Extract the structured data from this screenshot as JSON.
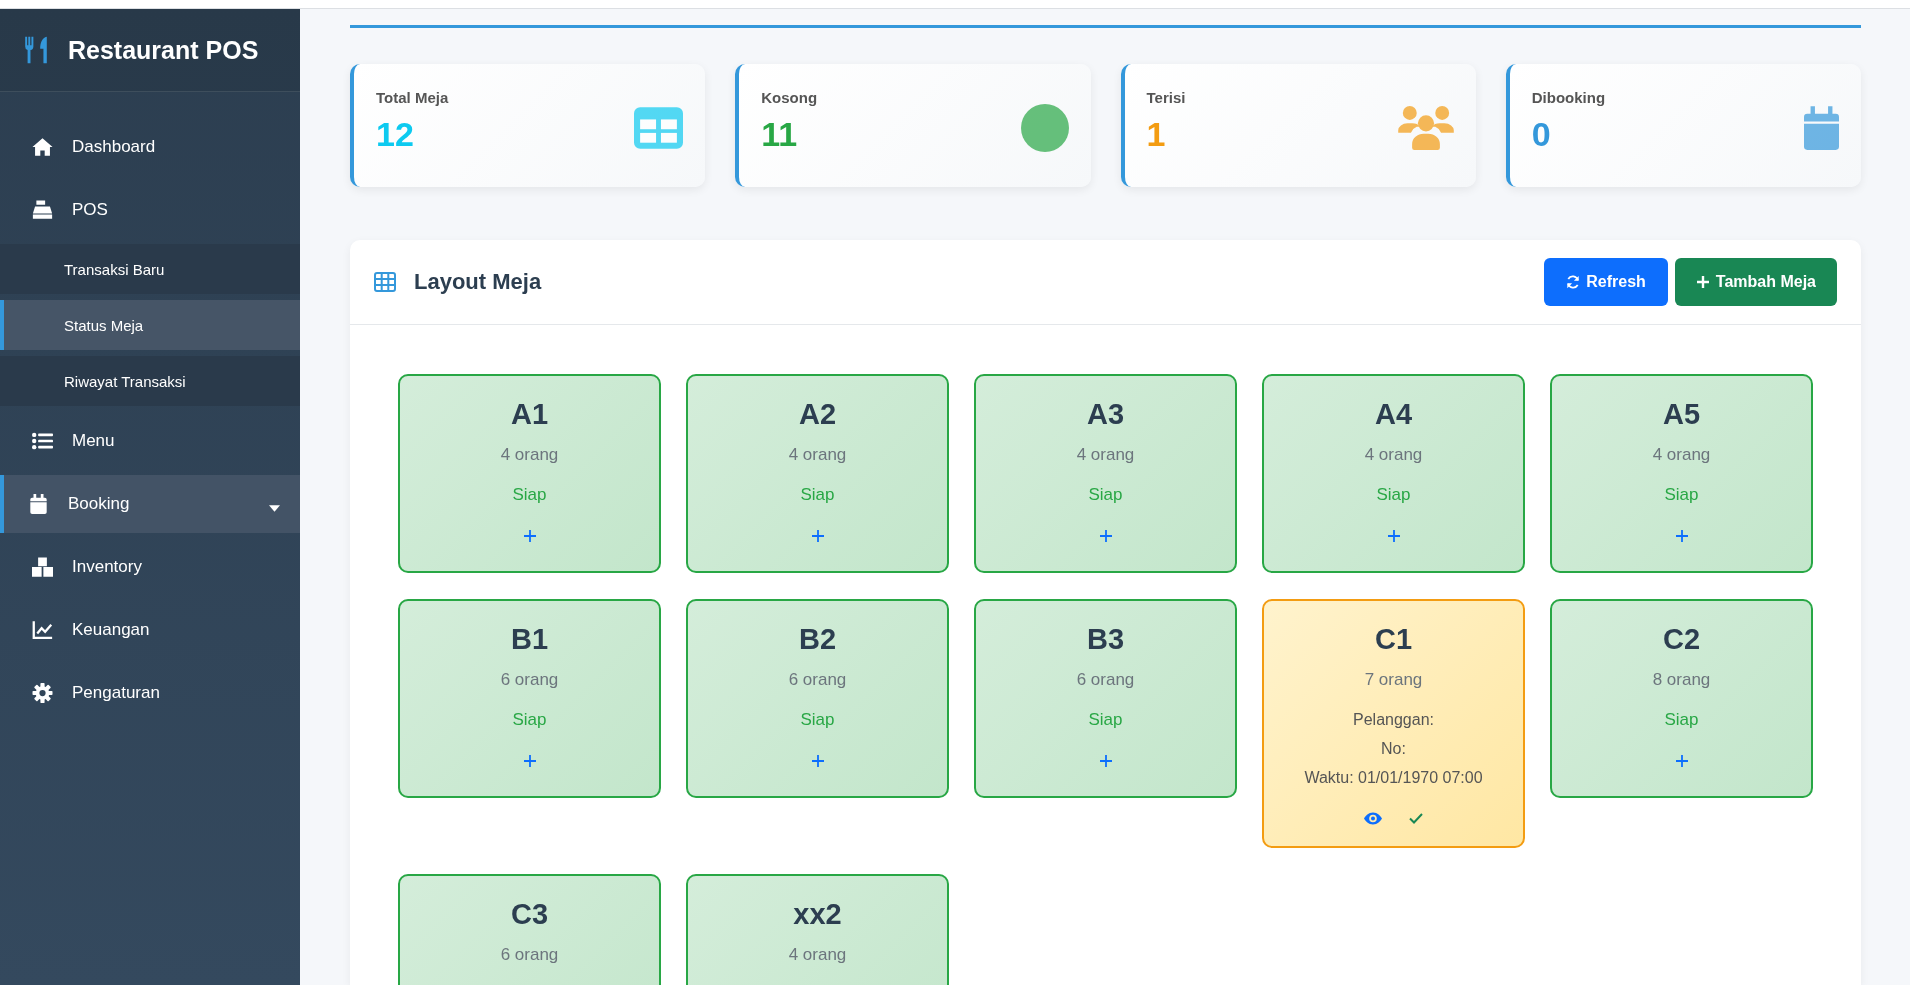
{
  "sidebar": {
    "brand": "Restaurant POS",
    "items": [
      {
        "label": "Dashboard",
        "kind": "link",
        "selected": false
      },
      {
        "label": "POS",
        "kind": "group",
        "selected": false,
        "children": [
          {
            "label": "Transaksi Baru",
            "selected": false
          },
          {
            "label": "Status Meja",
            "selected": true
          },
          {
            "label": "Riwayat Transaksi",
            "selected": false
          }
        ]
      },
      {
        "label": "Menu",
        "kind": "link",
        "selected": false
      },
      {
        "label": "Booking",
        "kind": "dropdown",
        "selected": true
      },
      {
        "label": "Inventory",
        "kind": "link",
        "selected": false
      },
      {
        "label": "Keuangan",
        "kind": "link",
        "selected": false
      },
      {
        "label": "Pengaturan",
        "kind": "link",
        "selected": false
      }
    ]
  },
  "stats": [
    {
      "label": "Total Meja",
      "value": "12",
      "color": "#0dcaf0"
    },
    {
      "label": "Kosong",
      "value": "11",
      "color": "#28a745"
    },
    {
      "label": "Terisi",
      "value": "1",
      "color": "#f39c12"
    },
    {
      "label": "Dibooking",
      "value": "0",
      "color": "#3498db"
    }
  ],
  "layout_panel": {
    "title": "Layout Meja",
    "buttons": [
      {
        "label": "Refresh",
        "kind": "primary"
      },
      {
        "label": "Tambah Meja",
        "kind": "success"
      }
    ],
    "tables": [
      {
        "name": "A1",
        "capacity": "4 orang",
        "kind": "available",
        "status": "Siap"
      },
      {
        "name": "A2",
        "capacity": "4 orang",
        "kind": "available",
        "status": "Siap"
      },
      {
        "name": "A3",
        "capacity": "4 orang",
        "kind": "available",
        "status": "Siap"
      },
      {
        "name": "A4",
        "capacity": "4 orang",
        "kind": "available",
        "status": "Siap"
      },
      {
        "name": "A5",
        "capacity": "4 orang",
        "kind": "available",
        "status": "Siap"
      },
      {
        "name": "B1",
        "capacity": "6 orang",
        "kind": "available",
        "status": "Siap"
      },
      {
        "name": "B2",
        "capacity": "6 orang",
        "kind": "available",
        "status": "Siap"
      },
      {
        "name": "B3",
        "capacity": "6 orang",
        "kind": "available",
        "status": "Siap"
      },
      {
        "name": "C1",
        "capacity": "7 orang",
        "kind": "occupied",
        "details": [
          "Pelanggan:",
          "No:",
          "Waktu: 01/01/1970 07:00"
        ]
      },
      {
        "name": "C2",
        "capacity": "8 orang",
        "kind": "available",
        "status": "Siap"
      },
      {
        "name": "C3",
        "capacity": "6 orang",
        "kind": "available"
      },
      {
        "name": "xx2",
        "capacity": "4 orang",
        "kind": "available"
      }
    ]
  }
}
